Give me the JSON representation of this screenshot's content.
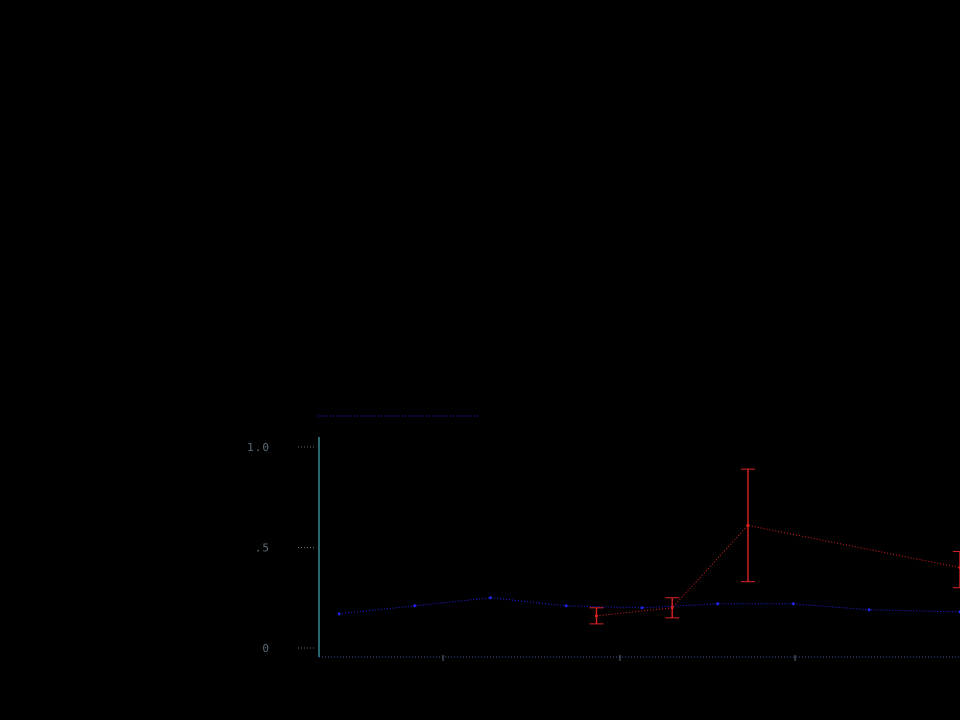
{
  "chart_data": {
    "type": "line",
    "ylabel": "",
    "xlabel": "",
    "legend": {
      "placement": "top"
    },
    "x_ticks": [
      "",
      "",
      "",
      "",
      ""
    ],
    "y_ticks": [
      {
        "value": 0,
        "label": "0"
      },
      {
        "value": 0.5,
        "label": ".5"
      },
      {
        "value": 1,
        "label": "1.0"
      }
    ],
    "xlim": [
      0,
      4.1
    ],
    "ylim": [
      0,
      1
    ],
    "series": [
      {
        "name": "",
        "color": "#2222ee",
        "x": [
          0,
          0.5,
          1,
          1.5,
          2,
          2.5,
          3,
          3.5,
          4.1
        ],
        "y": [
          0.17,
          0.21,
          0.25,
          0.21,
          0.2,
          0.22,
          0.22,
          0.19,
          0.18
        ],
        "labels": [
          "",
          "",
          "",
          "",
          "",
          "",
          "",
          "",
          ""
        ]
      },
      {
        "name": "",
        "color": "#dd2222",
        "x": [
          1.7,
          2.2,
          2.7,
          4.1
        ],
        "y": [
          0.16,
          0.2,
          0.61,
          0.4
        ],
        "err_low": [
          0.12,
          0.15,
          0.33,
          0.3
        ],
        "err_high": [
          0.2,
          0.25,
          0.89,
          0.48
        ],
        "labels": [
          "",
          "",
          "",
          ""
        ]
      }
    ]
  }
}
